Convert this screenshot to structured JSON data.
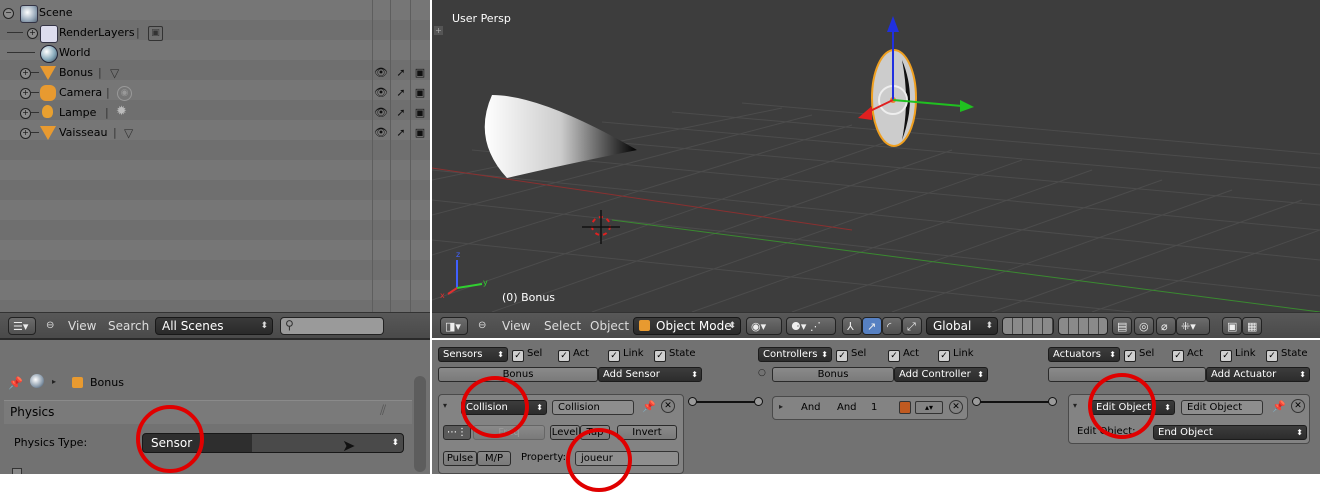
{
  "outliner": {
    "items": [
      {
        "label": "Scene"
      },
      {
        "label": "RenderLayers"
      },
      {
        "label": "World"
      },
      {
        "label": "Bonus"
      },
      {
        "label": "Camera"
      },
      {
        "label": "Lampe"
      },
      {
        "label": "Vaisseau"
      }
    ],
    "header": {
      "view": "View",
      "search": "Search",
      "scenes_select": "All Scenes"
    }
  },
  "viewport": {
    "overlay_title": "User Persp",
    "object_label": "(0) Bonus",
    "axis_x": "x",
    "axis_y": "y",
    "axis_z": "z",
    "header": {
      "view": "View",
      "select": "Select",
      "object": "Object",
      "mode": "Object Mode",
      "orientation": "Global"
    }
  },
  "properties": {
    "object_name": "Bonus",
    "section_title": "Physics",
    "physics_type_label": "Physics Type:",
    "physics_type_value": "Sensor"
  },
  "logic": {
    "sensors": {
      "menu": "Sensors",
      "sel": "Sel",
      "act": "Act",
      "link": "Link",
      "state": "State",
      "object": "Bonus",
      "add": "Add Sensor",
      "type": "Collision",
      "name": "Collision",
      "freq_label": "Freq",
      "level": "Level",
      "tap": "Tap",
      "invert": "Invert",
      "pulse": "Pulse",
      "mp": "M/P",
      "property_label": "Property:",
      "property_value": "joueur"
    },
    "controllers": {
      "menu": "Controllers",
      "sel": "Sel",
      "act": "Act",
      "link": "Link",
      "object": "Bonus",
      "add": "Add Controller",
      "type": "And",
      "name": "And",
      "state_num": "1"
    },
    "actuators": {
      "menu": "Actuators",
      "sel": "Sel",
      "act": "Act",
      "link": "Link",
      "state": "State",
      "add": "Add Actuator",
      "type": "Edit Object",
      "name": "Edit Object",
      "edit_object_label": "Edit Object:",
      "edit_object_value": "End Object"
    }
  },
  "colors": {
    "highlight_circle": "#e00000",
    "selected_outline": "#f0a020",
    "active_tab": "#5680c2"
  }
}
